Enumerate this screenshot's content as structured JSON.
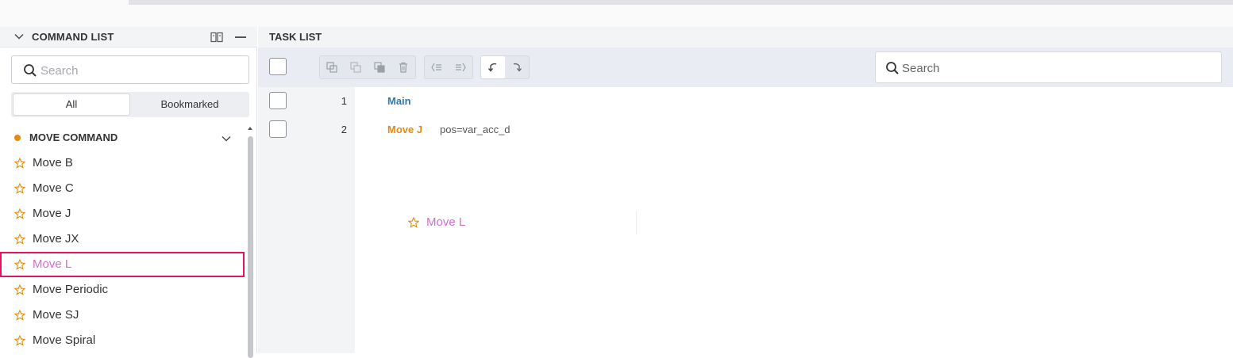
{
  "colors": {
    "accent_orange": "#e48a0e",
    "main_blue": "#2f7ab0",
    "selected_pink": "#d56cd3",
    "selection_outline": "#e0155e"
  },
  "command_panel": {
    "title": "COMMAND LIST",
    "search_placeholder": "Search",
    "filters": {
      "all": "All",
      "bookmarked": "Bookmarked",
      "active": "All"
    },
    "group": {
      "title": "MOVE COMMAND",
      "color": "#e48a0e",
      "expanded": true
    },
    "items": [
      {
        "label": "Move B"
      },
      {
        "label": "Move C"
      },
      {
        "label": "Move J"
      },
      {
        "label": "Move JX"
      },
      {
        "label": "Move L",
        "selected": true
      },
      {
        "label": "Move Periodic"
      },
      {
        "label": "Move SJ"
      },
      {
        "label": "Move Spiral"
      }
    ]
  },
  "task_panel": {
    "title": "TASK LIST",
    "search_placeholder": "Search",
    "toolbar_icons": [
      "copy-icon",
      "paste-icon",
      "duplicate-icon",
      "delete-icon",
      "outdent-icon",
      "indent-icon",
      "undo-icon",
      "redo-icon"
    ],
    "rows": [
      {
        "num": "1",
        "command": "Main",
        "param": "",
        "color": "#2f7ab0"
      },
      {
        "num": "2",
        "command": "Move J",
        "param": "pos=var_acc_d",
        "color": "#e48a0e"
      }
    ],
    "drag_ghost": {
      "label": "Move L"
    }
  }
}
